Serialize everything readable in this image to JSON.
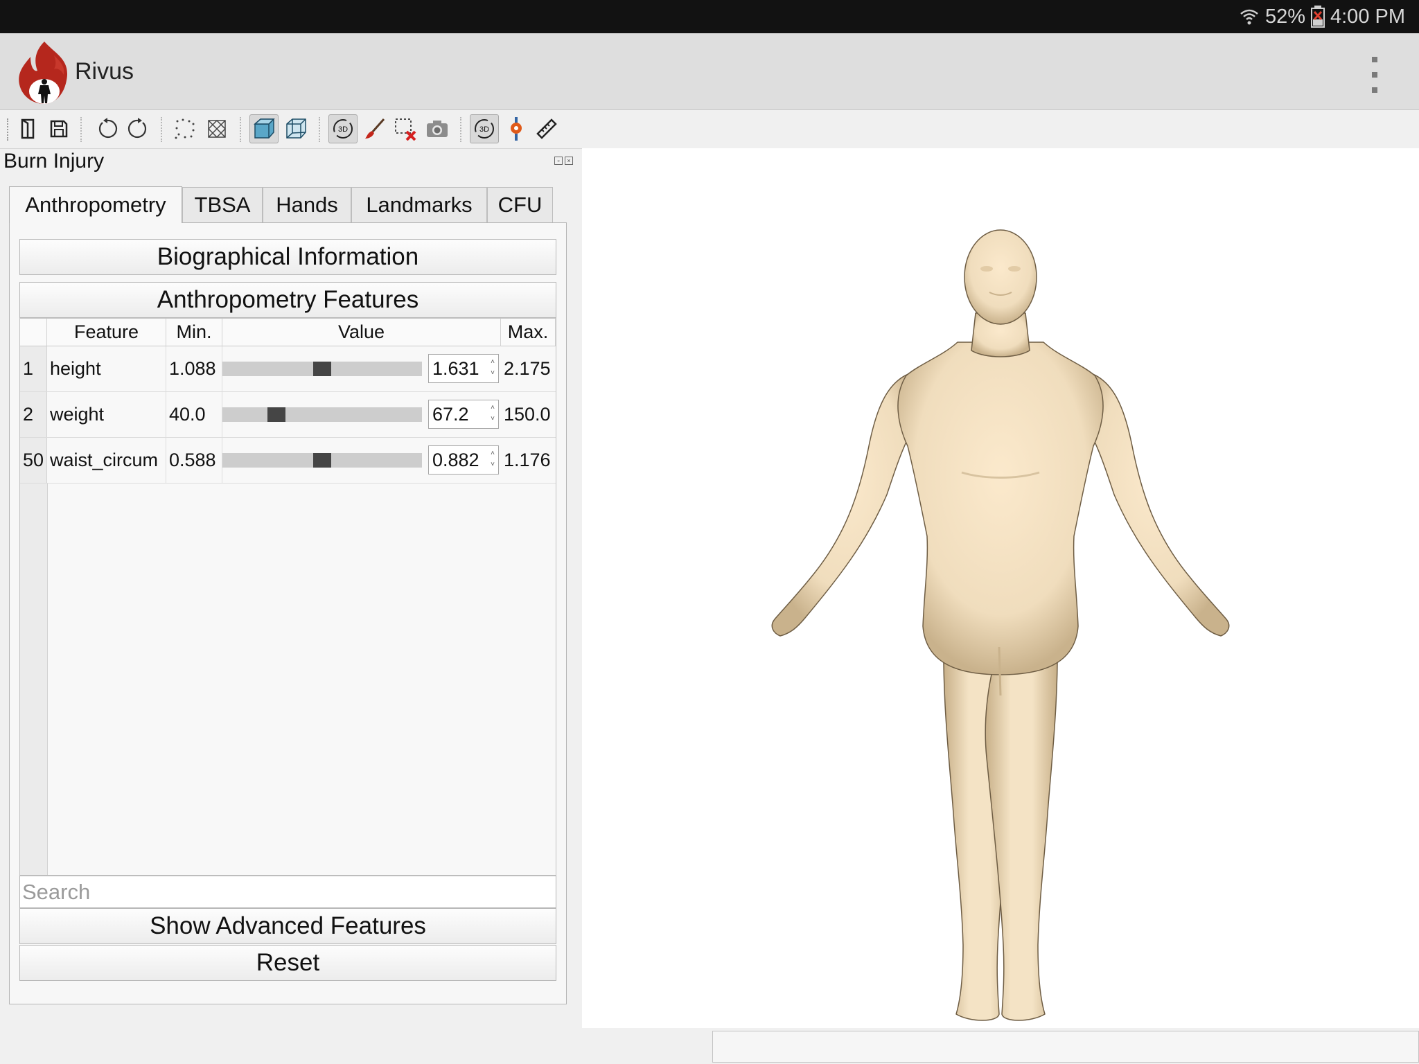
{
  "status_bar": {
    "battery": "52%",
    "time": "4:00 PM"
  },
  "app": {
    "title": "Rivus"
  },
  "panel": {
    "title": "Burn Injury"
  },
  "tabs": [
    {
      "label": "Anthropometry"
    },
    {
      "label": "TBSA"
    },
    {
      "label": "Hands"
    },
    {
      "label": "Landmarks"
    },
    {
      "label": "CFU"
    }
  ],
  "sections": {
    "biographical": "Biographical Information",
    "features": "Anthropometry Features"
  },
  "table": {
    "headers": {
      "feature": "Feature",
      "min": "Min.",
      "value": "Value",
      "max": "Max."
    },
    "rows": [
      {
        "index": "1",
        "feature": "height",
        "min": "1.088",
        "value": "1.631",
        "max": "2.175",
        "slider_fraction": 0.5
      },
      {
        "index": "2",
        "feature": "weight",
        "min": "40.0",
        "value": "67.2",
        "max": "150.0",
        "slider_fraction": 0.247
      },
      {
        "index": "50",
        "feature": "waist_circum",
        "min": "0.588",
        "value": "0.882",
        "max": "1.176",
        "slider_fraction": 0.5
      }
    ]
  },
  "search": {
    "placeholder": "Search"
  },
  "buttons": {
    "advanced": "Show Advanced Features",
    "reset": "Reset"
  },
  "toolbar": {
    "icons": [
      "new-file-icon",
      "save-icon",
      "undo-icon",
      "redo-icon",
      "points-icon",
      "wireframe-icon",
      "solid-view-icon",
      "transparent-view-icon",
      "rotate-3d-icon",
      "paintbrush-icon",
      "erase-selection-icon",
      "camera-icon",
      "rotate-3d-icon",
      "landmark-pin-icon",
      "ruler-icon"
    ]
  },
  "colors": {
    "skin": "#f0ddbd",
    "logo_red": "#b5271d",
    "status_bar": "#121212"
  }
}
